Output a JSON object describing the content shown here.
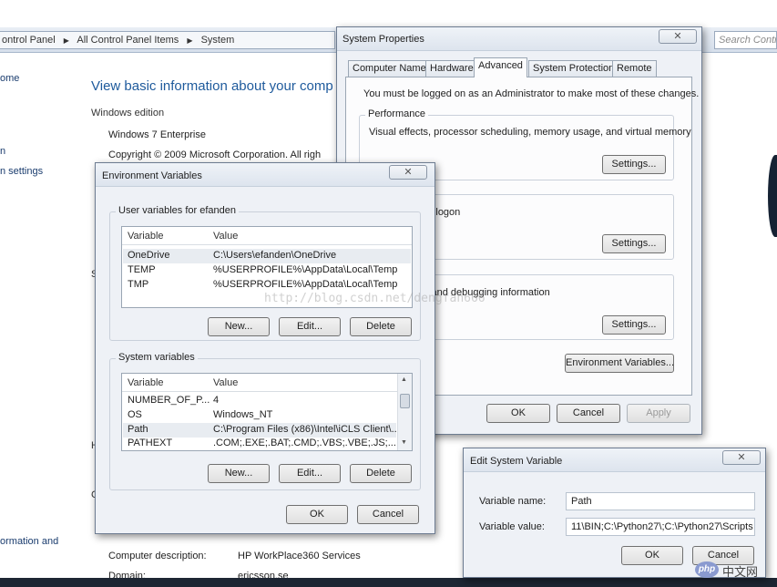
{
  "control_panel": {
    "breadcrumb": [
      "ontrol Panel",
      "All Control Panel Items",
      "System"
    ],
    "search_placeholder": "Search Contr",
    "left_links": [
      "ome",
      "n",
      "n settings",
      "ormation and"
    ],
    "title": "View basic information about your comp",
    "windows_edition_label": "Windows edition",
    "edition": "Windows 7 Enterprise",
    "copyright": "Copyright © 2009 Microsoft Corporation.  All righ",
    "computer_description_label": "Computer description:",
    "computer_description": "HP WorkPlace360 Services",
    "domain_label": "Domain:",
    "domain": "ericsson.se",
    "fragments": [
      "S",
      "H",
      "C"
    ]
  },
  "system_properties": {
    "title": "System Properties",
    "close": "✕",
    "tabs": [
      "Computer Name",
      "Hardware",
      "Advanced",
      "System Protection",
      "Remote"
    ],
    "admin_note": "You must be logged on as an Administrator to make most of these changes.",
    "performance": {
      "label": "Performance",
      "desc": "Visual effects, processor scheduling, memory usage, and virtual memory",
      "settings": "Settings..."
    },
    "profiles": {
      "desc": "related to your logon",
      "settings": "Settings..."
    },
    "startup": {
      "label": "overy",
      "desc": "ystem failure, and debugging information",
      "settings": "Settings..."
    },
    "env_button": "Environment Variables...",
    "ok": "OK",
    "cancel": "Cancel",
    "apply": "Apply"
  },
  "env_vars": {
    "title": "Environment Variables",
    "close": "✕",
    "user_group": "User variables for efanden",
    "col_variable": "Variable",
    "col_value": "Value",
    "user_rows": [
      {
        "name": "OneDrive",
        "value": "C:\\Users\\efanden\\OneDrive"
      },
      {
        "name": "TEMP",
        "value": "%USERPROFILE%\\AppData\\Local\\Temp"
      },
      {
        "name": "TMP",
        "value": "%USERPROFILE%\\AppData\\Local\\Temp"
      }
    ],
    "system_group": "System variables",
    "system_rows": [
      {
        "name": "NUMBER_OF_P...",
        "value": "4"
      },
      {
        "name": "OS",
        "value": "Windows_NT"
      },
      {
        "name": "Path",
        "value": "C:\\Program Files (x86)\\Intel\\iCLS Client\\..."
      },
      {
        "name": "PATHEXT",
        "value": ".COM;.EXE;.BAT;.CMD;.VBS;.VBE;.JS;...."
      }
    ],
    "new": "New...",
    "edit": "Edit...",
    "delete": "Delete",
    "ok": "OK",
    "cancel": "Cancel"
  },
  "edit_var": {
    "title": "Edit System Variable",
    "close": "✕",
    "name_label": "Variable name:",
    "name_value": "Path",
    "value_label": "Variable value:",
    "value_value": "11\\BIN;C:\\Python27\\;C:\\Python27\\Scripts",
    "ok": "OK",
    "cancel": "Cancel"
  },
  "watermark": "http://blog.csdn.net/dengfan666",
  "logo": {
    "badge": "php",
    "text": "中文网"
  },
  "colors": {
    "link": "#1e5a9c",
    "dialog_bg": "#eef1f6",
    "selection": "#e8ecf1"
  }
}
